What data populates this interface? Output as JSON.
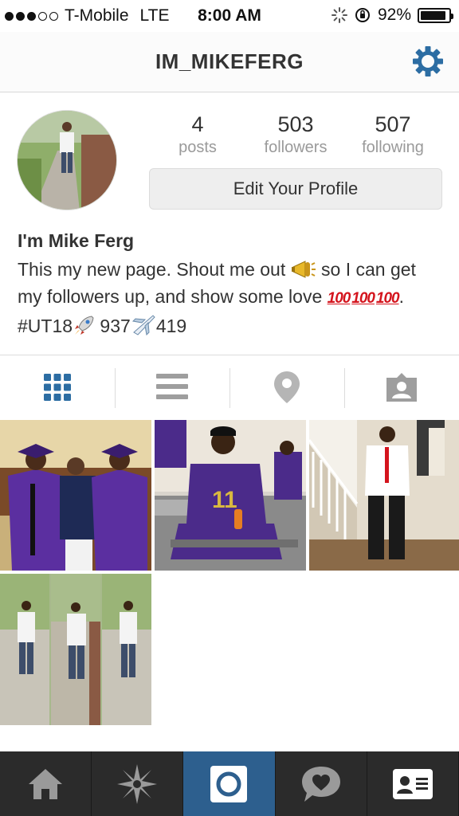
{
  "status_bar": {
    "carrier": "T-Mobile",
    "network": "LTE",
    "time": "8:00 AM",
    "battery": "92%",
    "battery_level": 0.92,
    "signal_bars": 3
  },
  "header": {
    "username": "IM_MIKEFERG",
    "settings_icon": "gear-icon",
    "accent": "#2c6da3"
  },
  "profile": {
    "stats": [
      {
        "value": "4",
        "label": "posts"
      },
      {
        "value": "503",
        "label": "followers"
      },
      {
        "value": "507",
        "label": "following"
      }
    ],
    "edit_button": "Edit Your Profile",
    "bio_name": "I'm Mike Ferg",
    "bio_part1": "This my new page. Shout me out ",
    "bio_part2": " so I can get my followers up, and show some love ",
    "bio_hundred": "100",
    "bio_part3": ". #UT18",
    "bio_part4": " 937",
    "bio_part5": "419"
  },
  "view_tabs": [
    {
      "name": "grid-view",
      "icon": "grid-icon",
      "active": true
    },
    {
      "name": "list-view",
      "icon": "list-icon",
      "active": false
    },
    {
      "name": "photo-map",
      "icon": "location-pin-icon",
      "active": false
    },
    {
      "name": "tagged-photos",
      "icon": "tagged-person-icon",
      "active": false
    }
  ],
  "photos": [
    {
      "description_icon": "graduation-photo-icon"
    },
    {
      "description_icon": "football-player-photo-icon"
    },
    {
      "description_icon": "formal-outfit-photo-icon"
    },
    {
      "description_icon": "collage-photo-icon"
    }
  ],
  "bottom_nav": [
    {
      "name": "home",
      "icon": "home-icon",
      "active": false
    },
    {
      "name": "explore",
      "icon": "explore-star-icon",
      "active": false
    },
    {
      "name": "camera",
      "icon": "camera-icon",
      "active": true
    },
    {
      "name": "activity",
      "icon": "heart-bubble-icon",
      "active": false
    },
    {
      "name": "profile",
      "icon": "profile-card-icon",
      "active": false
    }
  ],
  "colors": {
    "active_tab": "#2d5f8e",
    "bottom_bar": "#2b2b2b",
    "hundred_red": "#d4141d"
  }
}
